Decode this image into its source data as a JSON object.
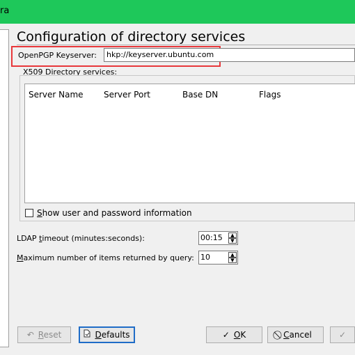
{
  "window": {
    "title_fragment": "ra"
  },
  "page": {
    "heading": "Configuration of directory services",
    "openpgp_label": "OpenPGP Keyserver:",
    "openpgp_value": "hkp://keyserver.ubuntu.com",
    "x509_label": "X509 Directory services:"
  },
  "table": {
    "columns": [
      "Server Name",
      "Server Port",
      "Base DN",
      "Flags"
    ],
    "rows": []
  },
  "options": {
    "show_user_label_underlined": "S",
    "show_user_label_rest": "how user and password information",
    "show_user_checked": false,
    "ldap_label_pre": "LDAP ",
    "ldap_label_ul": "t",
    "ldap_label_post": "imeout (minutes:seconds):",
    "ldap_value": "00:15",
    "max_label_ul": "M",
    "max_label_rest": "aximum number of items returned by query:",
    "max_value": "10"
  },
  "buttons": {
    "reset_ul": "R",
    "reset_rest": "eset",
    "defaults_ul": "D",
    "defaults_rest": "efaults",
    "ok_ul": "O",
    "ok_rest": "K",
    "cancel_ul": "C",
    "cancel_rest": "ancel"
  },
  "icons": {
    "reset": "undo-icon",
    "defaults": "document-icon",
    "ok": "checkmark-icon",
    "cancel": "cancel-circle-icon"
  },
  "colors": {
    "titlebar": "#1ec85a",
    "highlight": "#e8373a",
    "focus": "#1f6cc7"
  }
}
